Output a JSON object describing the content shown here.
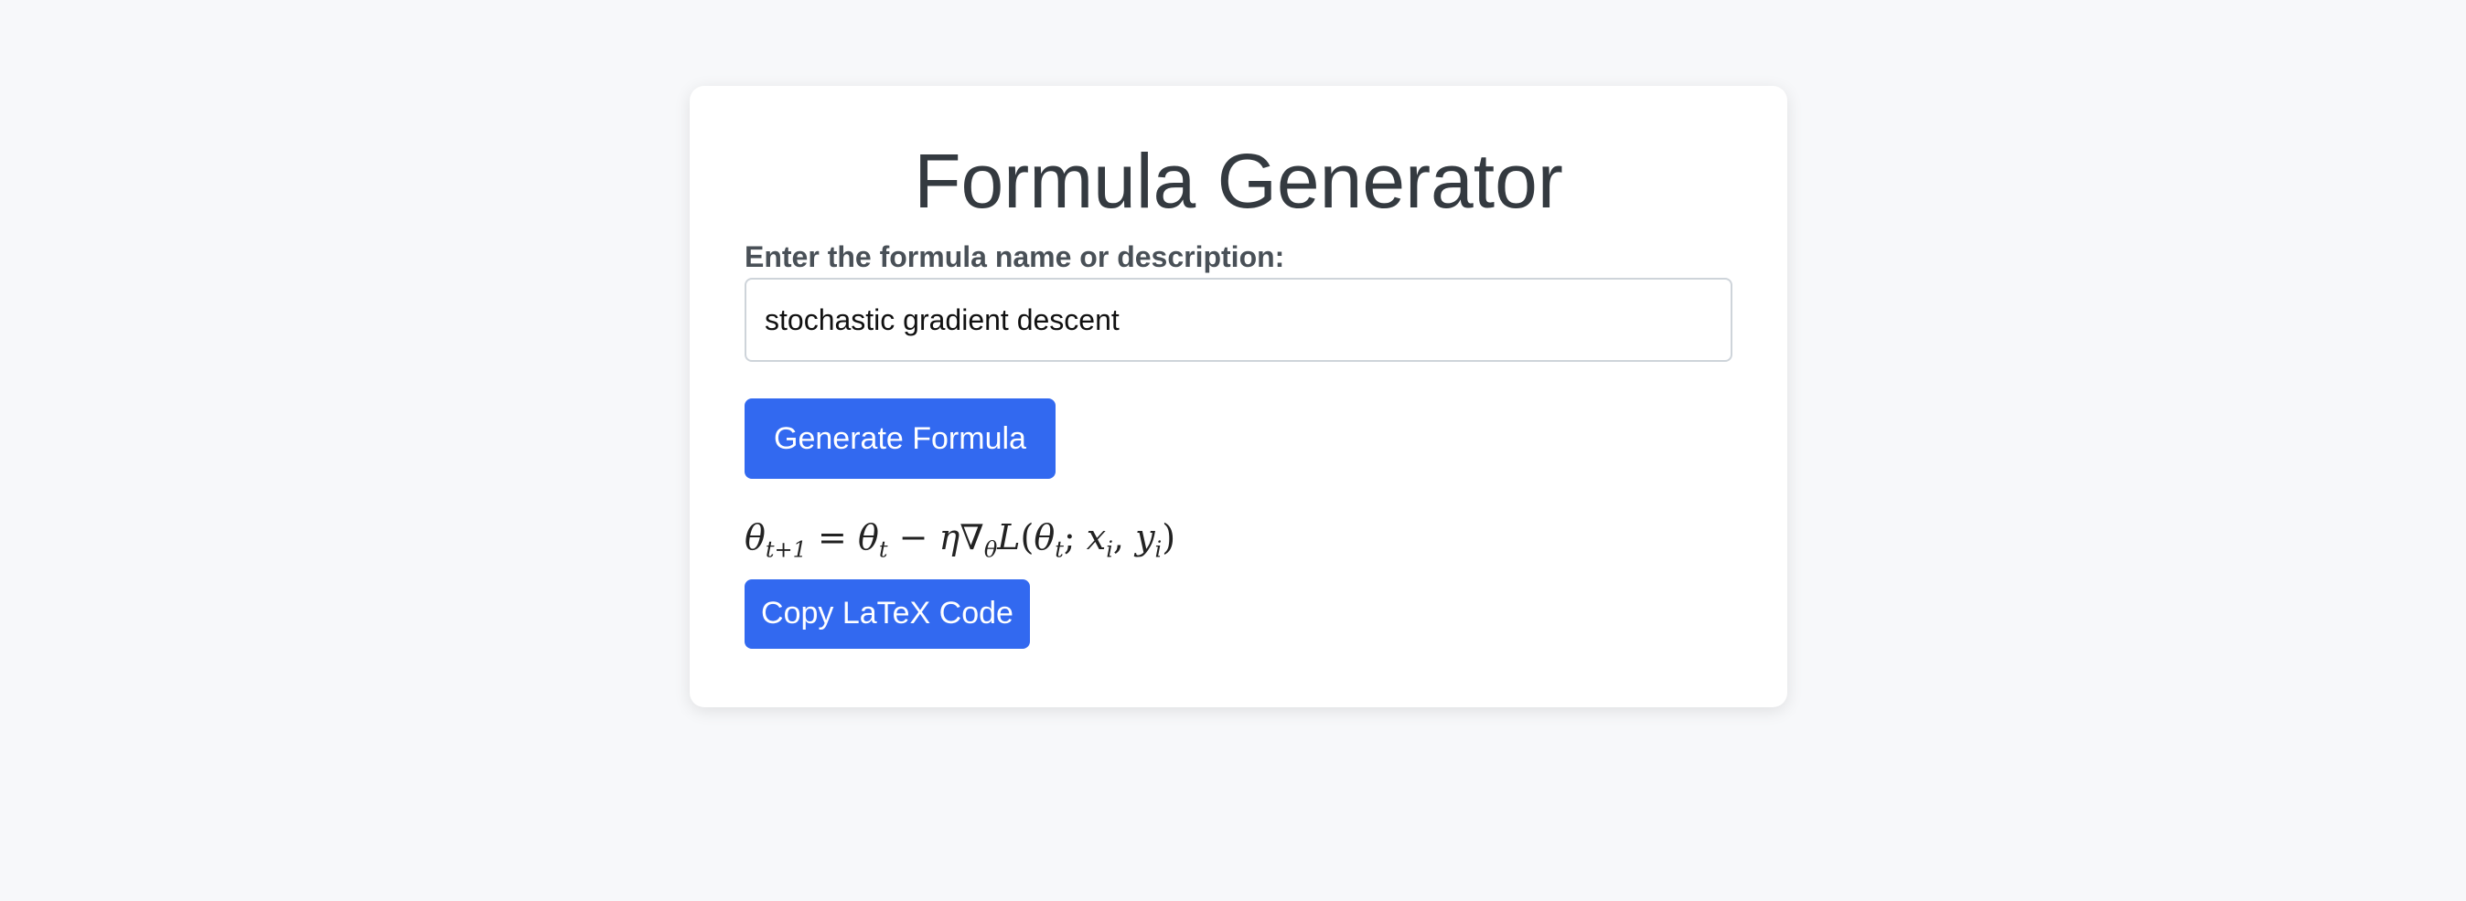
{
  "app": {
    "title": "Formula Generator"
  },
  "form": {
    "label": "Enter the formula name or description:",
    "input_value": "stochastic gradient descent",
    "generate_button": "Generate Formula"
  },
  "result": {
    "latex": "\\theta_{t+1} = \\theta_t - \\eta \\nabla_\\theta L(\\theta_t; x_i, y_i)",
    "copy_button": "Copy LaTeX Code"
  },
  "colors": {
    "accent": "#3269f0",
    "background": "#f7f8fa",
    "card": "#ffffff",
    "title_text": "#343a40",
    "label_text": "#495057"
  }
}
